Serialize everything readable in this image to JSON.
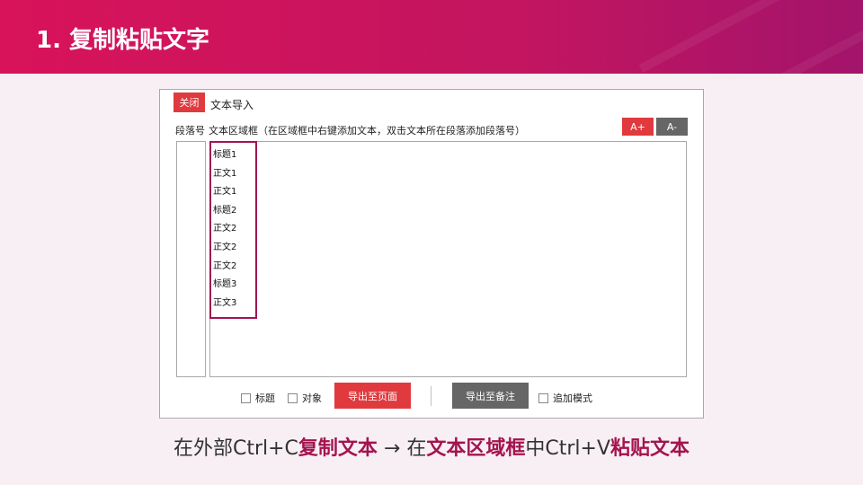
{
  "slide": {
    "title": "1. 复制粘贴文字"
  },
  "dialog": {
    "close_label": "关闭",
    "title": "文本导入",
    "para_label": "段落号",
    "area_label": "文本区域框（在区域框中右键添加文本，双击文本所在段落添加段落号）",
    "font_increase_label": "A+",
    "font_decrease_label": "A-",
    "lines": [
      "标题1",
      "正文1",
      "正文1",
      "标题2",
      "正文2",
      "正文2",
      "正文2",
      "标题3",
      "正文3"
    ],
    "footer": {
      "check_title_label": "标题",
      "check_object_label": "对象",
      "export_page_label": "导出至页面",
      "export_notes_label": "导出至备注",
      "check_append_label": "追加模式"
    }
  },
  "caption": {
    "part1": "在外部Ctrl+C",
    "part2": "复制文本",
    "part3": " → 在",
    "part4": "文本区域框",
    "part5": "中Ctrl+V",
    "part6": "粘贴文本"
  },
  "colors": {
    "accent_red": "#e03a3e",
    "accent_dark": "#666666",
    "highlight": "#a3144f"
  }
}
